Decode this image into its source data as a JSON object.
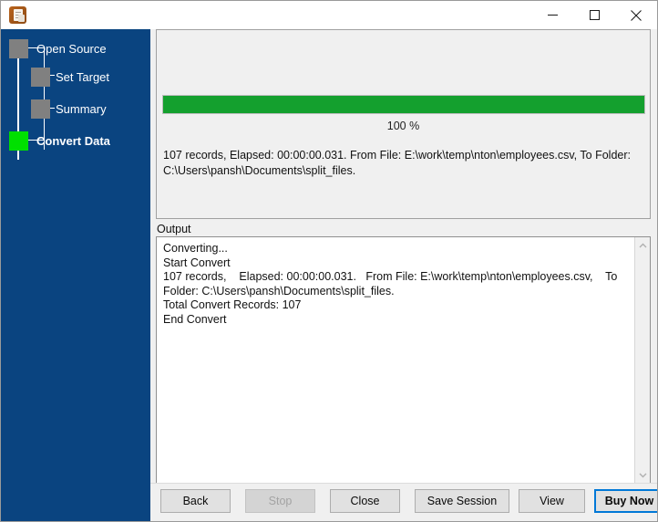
{
  "window": {
    "title": "",
    "icon": "app-document-icon",
    "controls": {
      "minimize": "minimize-icon",
      "maximize": "maximize-icon",
      "close": "close-icon"
    }
  },
  "sidebar": {
    "background_color": "#0a4480",
    "steps": [
      {
        "label": "Open Source",
        "state": "done",
        "marker_color": "#808080"
      },
      {
        "label": "Set Target",
        "state": "done",
        "marker_color": "#808080"
      },
      {
        "label": "Summary",
        "state": "done",
        "marker_color": "#808080"
      },
      {
        "label": "Convert Data",
        "state": "current",
        "marker_color": "#00e000"
      }
    ]
  },
  "progress": {
    "percent": 100,
    "percent_label": "100 %",
    "fill_color": "#14a02e"
  },
  "status": {
    "text": "107 records,    Elapsed: 00:00:00.031.   From File: E:\\work\\temp\\nton\\employees.csv,    To Folder: C:\\Users\\pansh\\Documents\\split_files."
  },
  "output": {
    "label": "Output",
    "lines": [
      "Converting...",
      "Start Convert",
      "107 records,    Elapsed: 00:00:00.031.   From File: E:\\work\\temp\\nton\\employees.csv,    To Folder: C:\\Users\\pansh\\Documents\\split_files.",
      "Total Convert Records: 107",
      "End Convert"
    ],
    "scrollbar": {
      "up_arrow": "chevron-up-icon",
      "down_arrow": "chevron-down-icon"
    }
  },
  "buttons": [
    {
      "label": "Back",
      "state": "enabled"
    },
    {
      "label": "Stop",
      "state": "disabled"
    },
    {
      "label": "Close",
      "state": "enabled"
    },
    {
      "label": "Save Session",
      "state": "enabled"
    },
    {
      "label": "View",
      "state": "enabled"
    },
    {
      "label": "Buy Now",
      "state": "focused"
    }
  ]
}
